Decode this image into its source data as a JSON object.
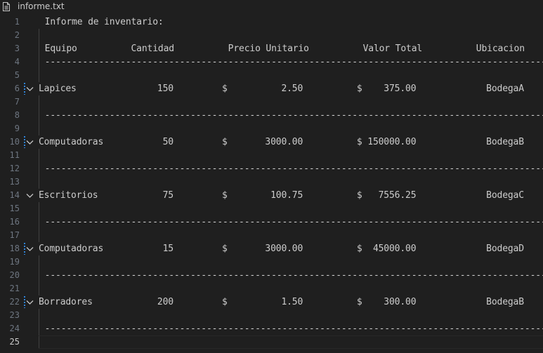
{
  "tab": {
    "title": "informe.txt",
    "icon": "file-text-icon"
  },
  "colors": {
    "background": "#1f1f1f",
    "text": "#cccccc",
    "line_number": "#6e7681",
    "modified_bar": "#2f83d8"
  },
  "lines": [
    {
      "num": "1",
      "text": " Informe de inventario:"
    },
    {
      "num": "2",
      "text": ""
    },
    {
      "num": "3",
      "text": " Equipo          Cantidad          Precio Unitario          Valor Total          Ubicacion"
    },
    {
      "num": "4",
      "text": " ----------------------------------------------------------------------------------------------"
    },
    {
      "num": "5",
      "text": ""
    },
    {
      "num": "6",
      "text": "Lapices               150         $          2.50          $    375.00             BodegaA"
    },
    {
      "num": "7",
      "text": ""
    },
    {
      "num": "8",
      "text": " ----------------------------------------------------------------------------------------------"
    },
    {
      "num": "9",
      "text": ""
    },
    {
      "num": "10",
      "text": "Computadoras           50         $       3000.00          $ 150000.00             BodegaB"
    },
    {
      "num": "11",
      "text": ""
    },
    {
      "num": "12",
      "text": " ----------------------------------------------------------------------------------------------"
    },
    {
      "num": "13",
      "text": ""
    },
    {
      "num": "14",
      "text": "Escritorios            75         $        100.75          $   7556.25             BodegaC"
    },
    {
      "num": "15",
      "text": ""
    },
    {
      "num": "16",
      "text": " ----------------------------------------------------------------------------------------------"
    },
    {
      "num": "17",
      "text": ""
    },
    {
      "num": "18",
      "text": "Computadoras           15         $       3000.00          $  45000.00             BodegaD"
    },
    {
      "num": "19",
      "text": ""
    },
    {
      "num": "20",
      "text": " ----------------------------------------------------------------------------------------------"
    },
    {
      "num": "21",
      "text": ""
    },
    {
      "num": "22",
      "text": "Borradores            200         $          1.50          $    300.00             BodegaB"
    },
    {
      "num": "23",
      "text": ""
    },
    {
      "num": "24",
      "text": " ----------------------------------------------------------------------------------------------"
    },
    {
      "num": "25",
      "text": ""
    }
  ]
}
